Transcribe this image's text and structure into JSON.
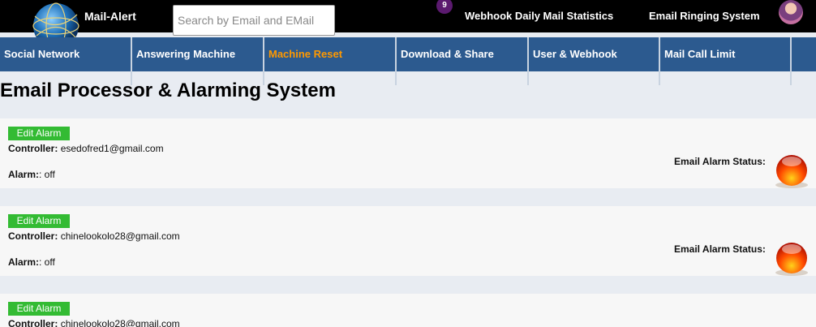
{
  "header": {
    "brand": "Mail-Alert",
    "search_placeholder": "Search by Email and EMail",
    "notification_count": "9",
    "links": [
      "Webhook Daily Mail Statistics",
      "Email Ringing System"
    ]
  },
  "nav": {
    "items": [
      {
        "label": "Social Network"
      },
      {
        "label": "Answering Machine"
      },
      {
        "label": "Machine Reset",
        "active": true
      },
      {
        "label": "Download & Share"
      },
      {
        "label": "User & Webhook"
      },
      {
        "label": "Mail Call Limit"
      }
    ]
  },
  "page": {
    "title": "Email Processor & Alarming System"
  },
  "alarms": [
    {
      "edit_label": "Edit Alarm",
      "controller_label": "Controller:",
      "controller": "esedofred1@gmail.com",
      "alarm_label": "Alarm:",
      "alarm_value": ": off",
      "status_label": "Email Alarm Status:"
    },
    {
      "edit_label": "Edit Alarm",
      "controller_label": "Controller:",
      "controller": "chinelookolo28@gmail.com",
      "alarm_label": "Alarm:",
      "alarm_value": ": off",
      "status_label": "Email Alarm Status:"
    },
    {
      "edit_label": "Edit Alarm",
      "controller_label": "Controller:",
      "controller": "chinelookolo28@gmail.com"
    }
  ],
  "colors": {
    "topbar": "#000000",
    "nav": "#2c5a8f",
    "nav_active": "#ff9900",
    "edit_button": "#33bb33",
    "alarm_off_lamp": "#e53000"
  }
}
